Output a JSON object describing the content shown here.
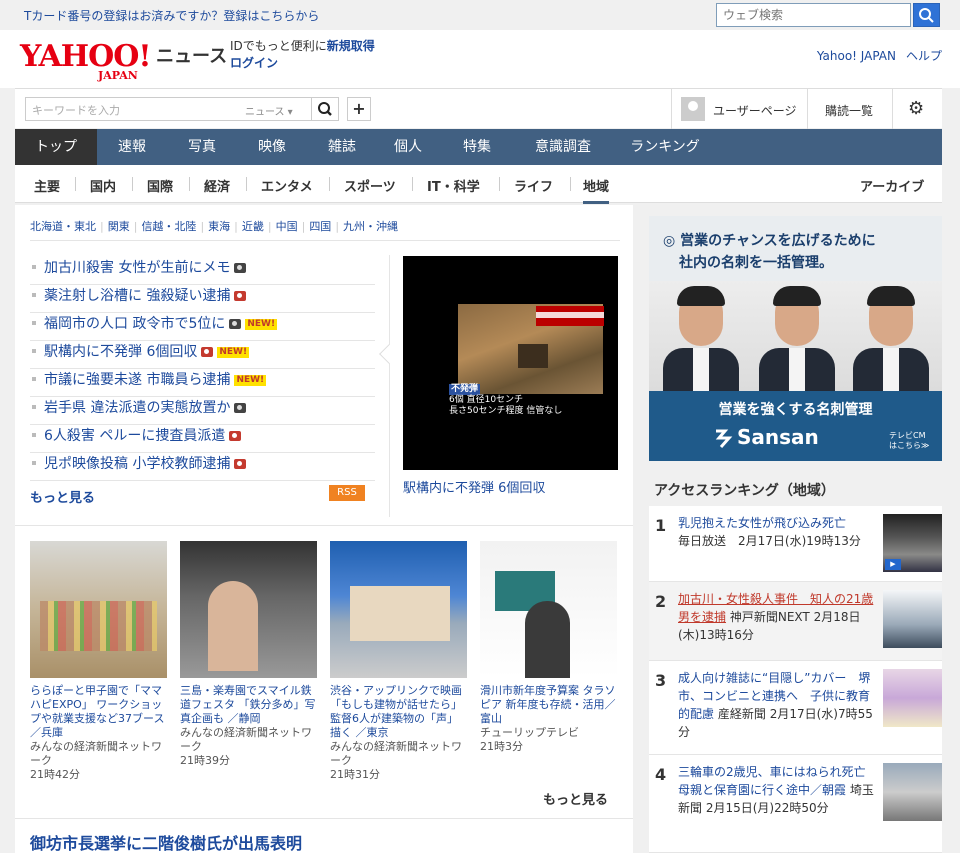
{
  "topbar": {
    "tcard_text": "Tカード番号の登録はお済みですか？登録はこちらから",
    "web_search_placeholder": "ウェブ検索"
  },
  "header": {
    "logo_main": "YAHOO!",
    "logo_sub": "JAPAN",
    "section_name": "ニュース",
    "id_prompt": "IDでもっと便利に",
    "id_register": "新規取得",
    "login": "ログイン",
    "links": [
      "Yahoo! JAPAN",
      "ヘルプ"
    ]
  },
  "searchbar": {
    "keyword_placeholder": "キーワードを入力",
    "scope": "ニュース ▾",
    "user_page": "ユーザーページ",
    "subscriptions": "購読一覧"
  },
  "main_nav": {
    "tabs": [
      "トップ",
      "速報",
      "写真",
      "映像",
      "雑誌",
      "個人",
      "特集",
      "意識調査",
      "ランキング"
    ],
    "active_index": 0
  },
  "sub_nav": {
    "items": [
      "主要",
      "国内",
      "国際",
      "経済",
      "エンタメ",
      "スポーツ",
      "IT・科学",
      "ライフ",
      "地域"
    ],
    "active_index": 8,
    "archive": "アーカイブ"
  },
  "regions": [
    "北海道・東北",
    "関東",
    "信越・北陸",
    "東海",
    "近畿",
    "中国",
    "四国",
    "九州・沖縄"
  ],
  "headlines": [
    {
      "title": "加古川殺害 女性が生前にメモ",
      "badge": "cam"
    },
    {
      "title": "薬注射し浴槽に 強殺疑い逮捕",
      "badge": "vid"
    },
    {
      "title": "福岡市の人口 政令市で5位に",
      "badge": "cam",
      "new": "NEW!"
    },
    {
      "title": "駅構内に不発弾 6個回収",
      "badge": "vid",
      "new": "NEW!"
    },
    {
      "title": "市議に強要未遂 市職員ら逮捕",
      "badge": "",
      "new": "NEW!"
    },
    {
      "title": "岩手県 違法派遣の実態放置か",
      "badge": "cam"
    },
    {
      "title": "6人殺害 ペルーに捜査員派遣",
      "badge": "vid"
    },
    {
      "title": "児ポ映像投稿 小学校教師逮捕",
      "badge": "vid"
    }
  ],
  "more_link": "もっと見る",
  "rss": "RSS",
  "top_photo": {
    "caption": "駅構内に不発弾 6個回収",
    "overlay_label": "不発弾",
    "overlay_line1": "6個 直径10センチ",
    "overlay_line2": "長さ50センチ程度 信管なし"
  },
  "thumbnails": [
    {
      "title": "ららぽーと甲子園で「ママハピEXPO」 ワークショップや就業支援など37ブース ／兵庫",
      "source": "みんなの経済新聞ネットワーク",
      "time": "21時42分"
    },
    {
      "title": "三島・楽寿園でスマイル鉄道フェスタ 「鉄分多め」写真企画も ／静岡",
      "source": "みんなの経済新聞ネットワーク",
      "time": "21時39分"
    },
    {
      "title": "渋谷・アップリンクで映画「もしも建物が話せたら」 監督6人が建築物の「声」描く ／東京",
      "source": "みんなの経済新聞ネットワーク",
      "time": "21時31分"
    },
    {
      "title": "滑川市新年度予算案 タラソピア 新年度も存続・活用／富山",
      "source": "チューリップテレビ",
      "time": "21時3分"
    }
  ],
  "more_link2": "もっと見る",
  "big_headline": "御坊市長選挙に二階俊樹氏が出馬表明",
  "ad": {
    "line1": "◎ 営業のチャンスを広げるために",
    "line2": "社内の名刺を一括管理。",
    "slogan": "営業を強くする名刺管理",
    "brand": "Sansan",
    "cm1": "テレビCM",
    "cm2": "はこちら≫"
  },
  "ranking": {
    "title": "アクセスランキング（地域）",
    "items": [
      {
        "num": "1",
        "title": "乳児抱えた女性が飛び込み死亡",
        "source": "毎日放送",
        "time": "2月17日(水)19時13分"
      },
      {
        "num": "2",
        "title": "加古川・女性殺人事件　知人の21歳男を逮捕",
        "source": "神戸新聞NEXT",
        "time": "2月18日(木)13時16分"
      },
      {
        "num": "3",
        "title": "成人向け雑誌に“目隠し”カバー　堺市、コンビニと連携へ　子供に教育的配慮",
        "source": "産経新聞",
        "time": "2月17日(水)7時55分"
      },
      {
        "num": "4",
        "title": "三輪車の2歳児、車にはねられ死亡　母親と保育園に行く途中／朝霞",
        "source": "埼玉新聞",
        "time": "2月15日(月)22時50分"
      }
    ]
  },
  "colors": {
    "nav_bg": "#416082",
    "link": "#1d4a9c",
    "logo_red": "#e60012",
    "rss": "#f08221"
  }
}
